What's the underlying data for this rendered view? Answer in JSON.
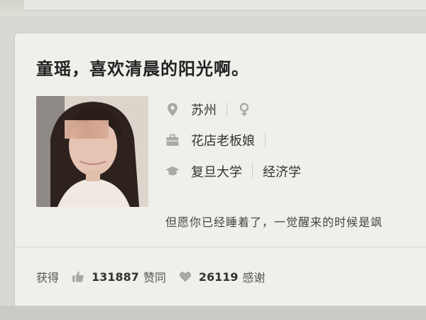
{
  "profile": {
    "headline": "童瑶，喜欢清晨的阳光啊。",
    "location": "苏州",
    "gender_icon": "female-icon",
    "job": "花店老板娘",
    "school": "复旦大学",
    "major": "经济学",
    "bio": "但愿你已经睡着了，一觉醒来的时候是飒"
  },
  "stats": {
    "prefix": "获得",
    "likes_count": "131887",
    "likes_label": "赞同",
    "thanks_count": "26119",
    "thanks_label": "感谢"
  },
  "icons": {
    "location": "map-pin-icon",
    "job": "briefcase-icon",
    "education": "graduation-cap-icon",
    "likes": "thumbs-up-icon",
    "thanks": "heart-icon"
  },
  "colors": {
    "background": "#efefeb",
    "text": "#3b3b3b",
    "icon": "#a9a9a4"
  }
}
